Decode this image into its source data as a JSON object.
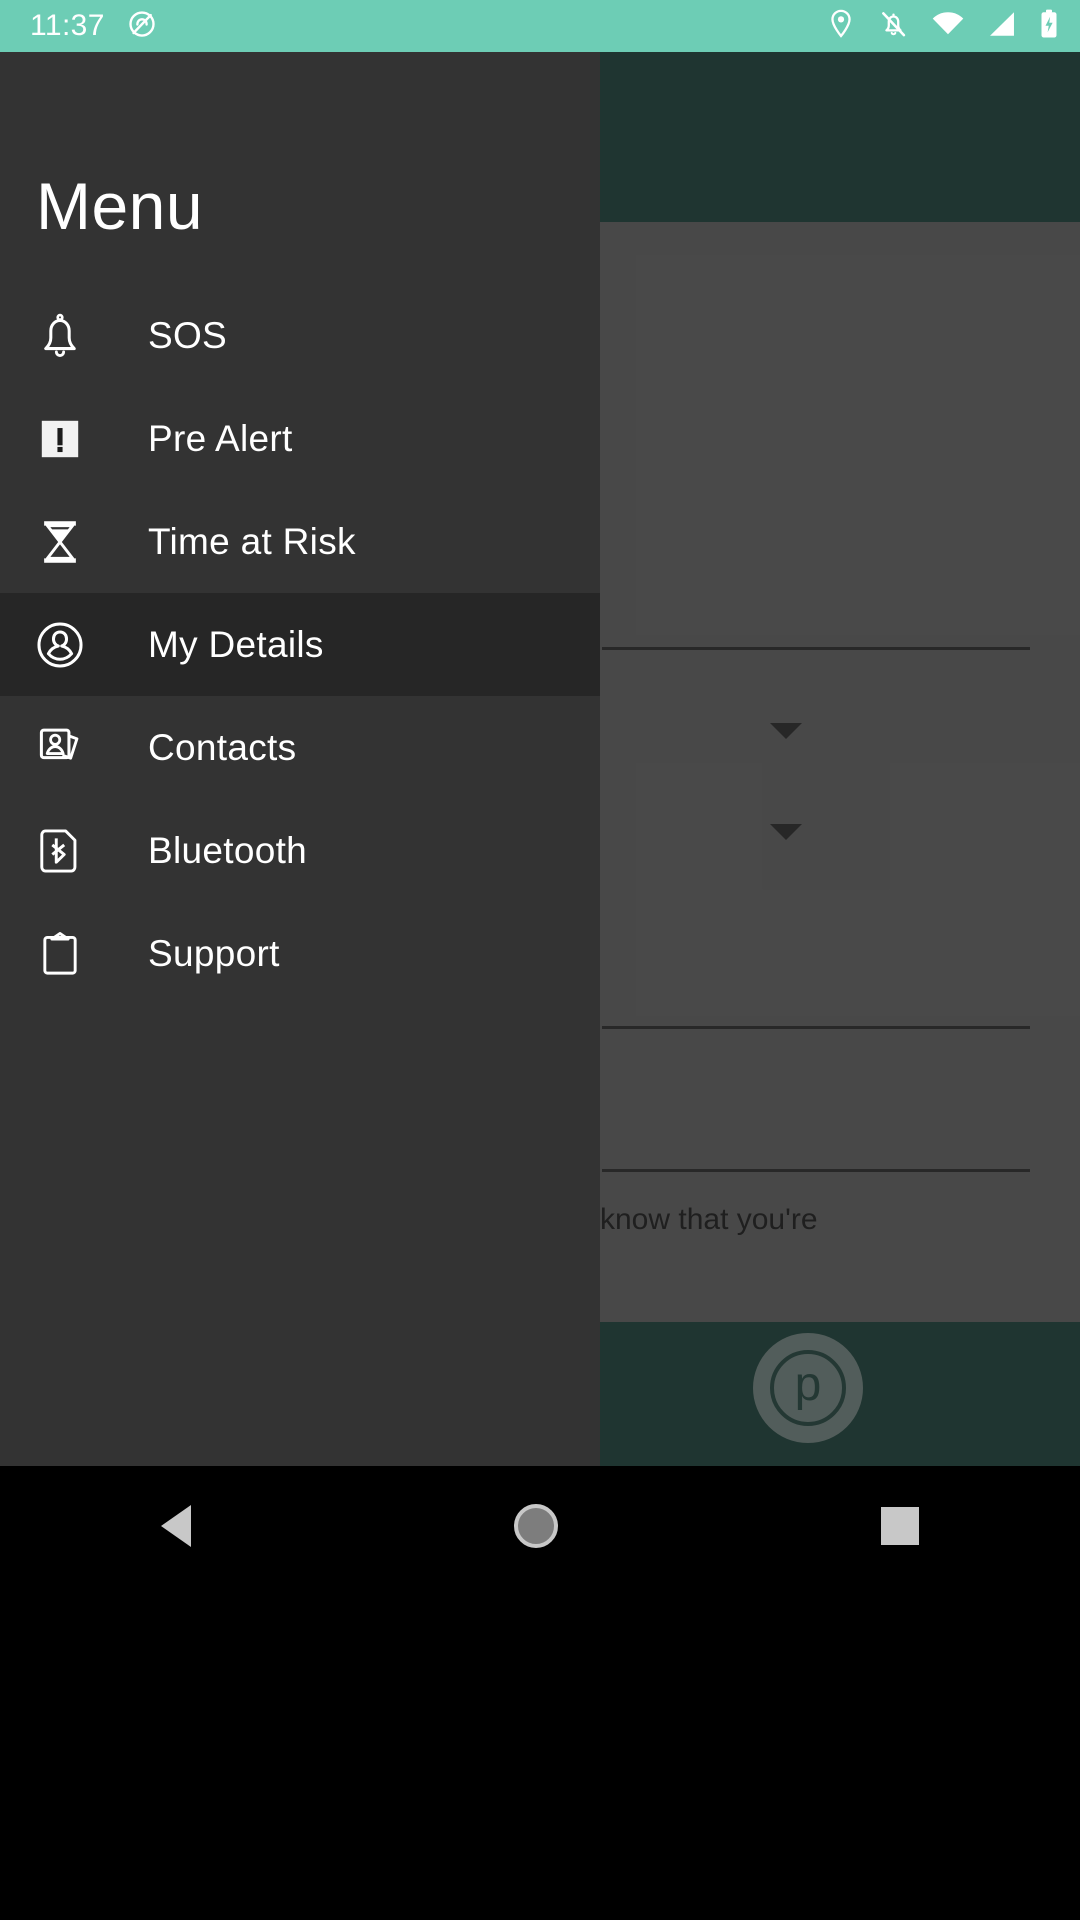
{
  "status_bar": {
    "time": "11:37",
    "background_color": "#6dcdb5",
    "icons": [
      {
        "name": "do-not-disturb-icon",
        "position": "left"
      },
      {
        "name": "location-pin-icon",
        "position": "right"
      },
      {
        "name": "notifications-muted-icon",
        "position": "right"
      },
      {
        "name": "wifi-icon",
        "position": "right"
      },
      {
        "name": "cellular-signal-icon",
        "position": "right"
      },
      {
        "name": "battery-charging-icon",
        "position": "right"
      }
    ]
  },
  "drawer": {
    "title": "Menu",
    "background_color": "#333333",
    "selected_item": "My Details",
    "items": [
      {
        "label": "SOS",
        "icon": "bell-icon",
        "selected": false
      },
      {
        "label": "Pre Alert",
        "icon": "alert-square-icon",
        "selected": false
      },
      {
        "label": "Time at Risk",
        "icon": "hourglass-icon",
        "selected": false
      },
      {
        "label": "My Details",
        "icon": "user-circle-icon",
        "selected": true
      },
      {
        "label": "Contacts",
        "icon": "contact-cards-icon",
        "selected": false
      },
      {
        "label": "Bluetooth",
        "icon": "bluetooth-card-icon",
        "selected": false
      },
      {
        "label": "Support",
        "icon": "clipboard-icon",
        "selected": false
      }
    ]
  },
  "background_screen": {
    "header_color": "#2f4f49",
    "form_color": "#6b6b6b",
    "partial_text": "know that you're",
    "fab_label": "p",
    "dropdowns": [
      {
        "name": "dropdown-caret-1"
      },
      {
        "name": "dropdown-caret-2"
      }
    ]
  },
  "nav_bar": {
    "background_color": "#000000",
    "buttons": [
      {
        "label": "Back",
        "icon": "back-triangle-icon"
      },
      {
        "label": "Home",
        "icon": "home-circle-icon"
      },
      {
        "label": "Recents",
        "icon": "recents-square-icon"
      }
    ]
  }
}
